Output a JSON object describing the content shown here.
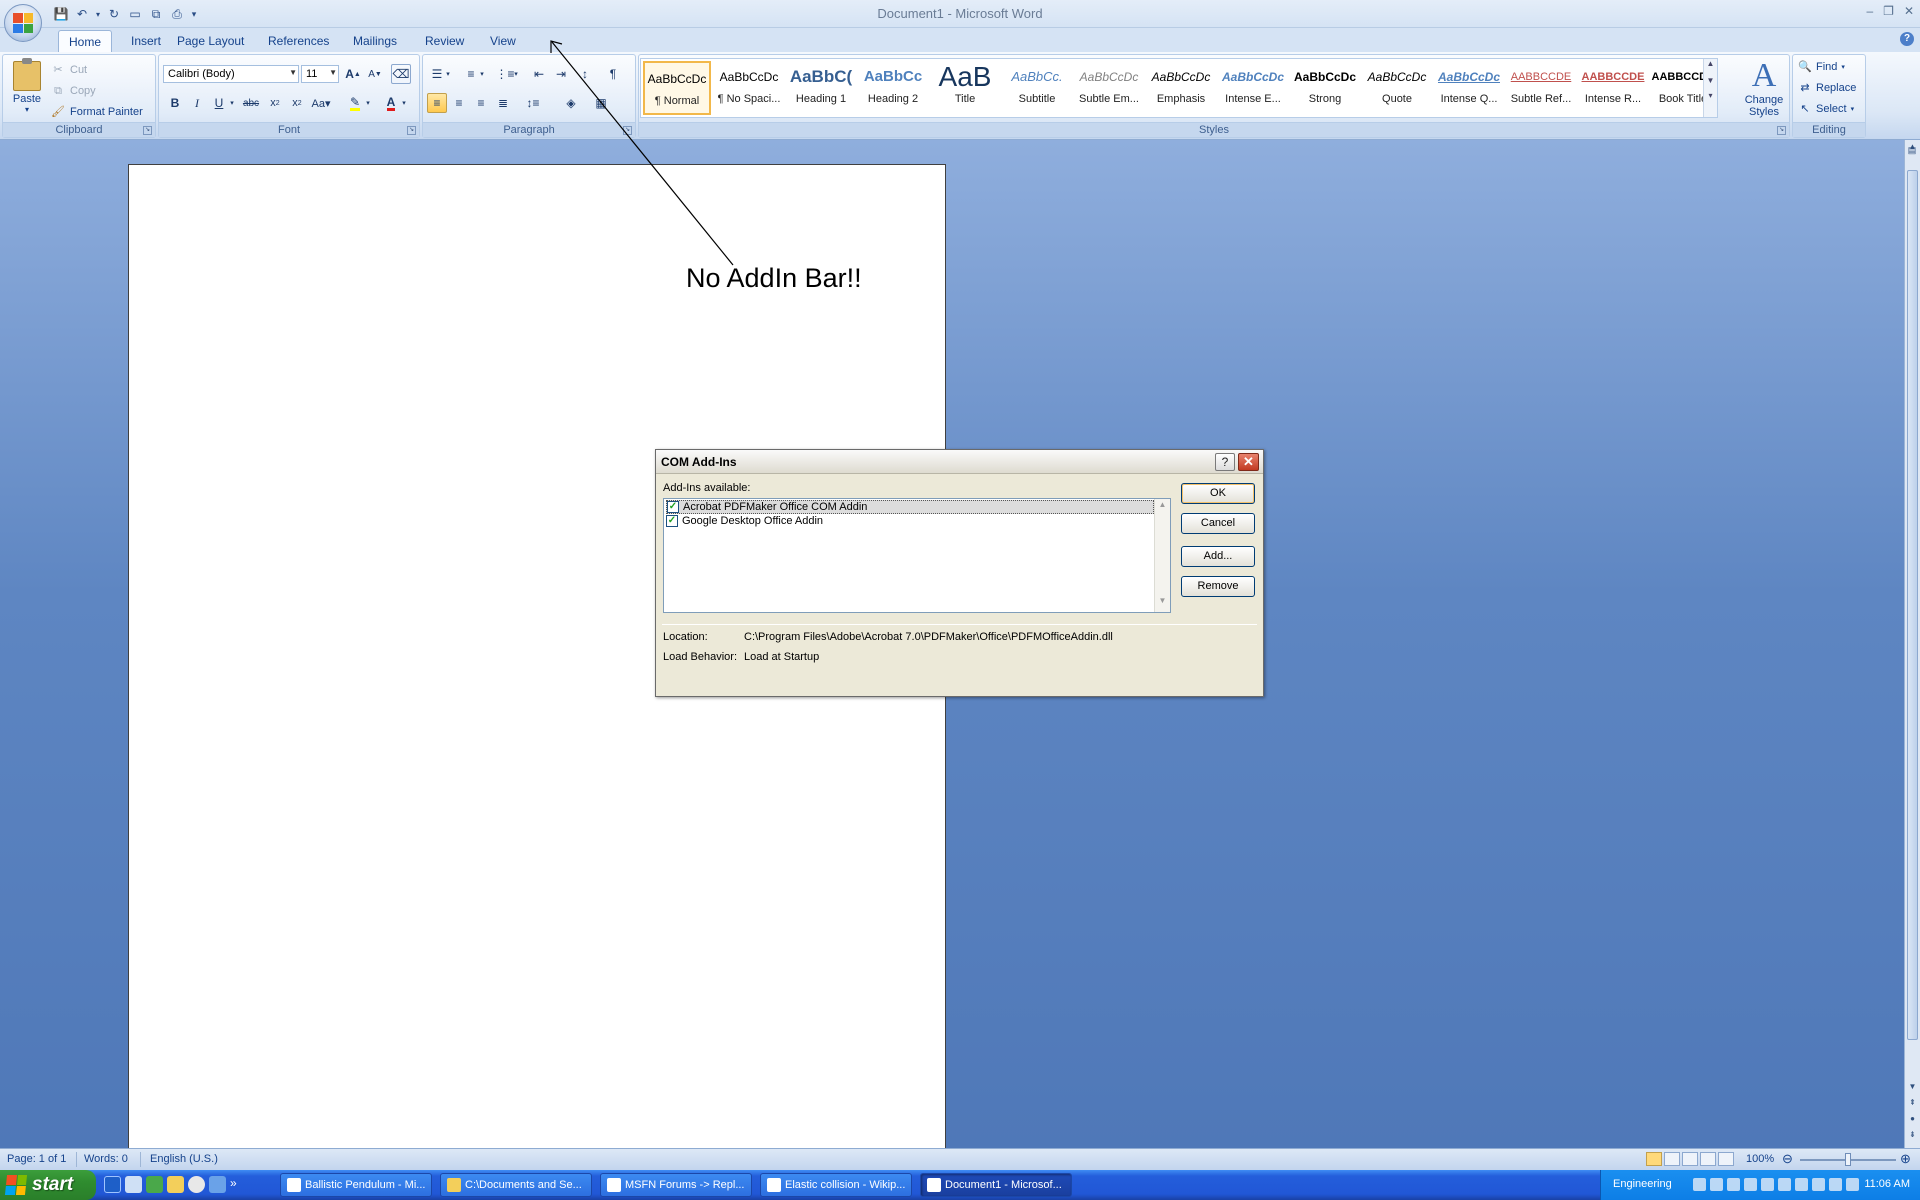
{
  "window": {
    "title": "Document1 - Microsoft Word",
    "controls": [
      "–",
      "❐",
      "✕"
    ]
  },
  "tabs": [
    "Home",
    "Insert",
    "Page Layout",
    "References",
    "Mailings",
    "Review",
    "View"
  ],
  "active_tab": "Home",
  "ribbon": {
    "clipboard": {
      "label": "Clipboard",
      "paste": "Paste",
      "cut": "Cut",
      "copy": "Copy",
      "format_painter": "Format Painter"
    },
    "font": {
      "label": "Font",
      "font_name": "Calibri (Body)",
      "font_size": "11"
    },
    "paragraph": {
      "label": "Paragraph"
    },
    "styles": {
      "label": "Styles",
      "items": [
        {
          "sample": "AaBbCcDc",
          "name": "¶ Normal"
        },
        {
          "sample": "AaBbCcDc",
          "name": "¶ No Spaci..."
        },
        {
          "sample": "AaBbC(",
          "name": "Heading 1"
        },
        {
          "sample": "AaBbCc",
          "name": "Heading 2"
        },
        {
          "sample": "AaB",
          "name": "Title"
        },
        {
          "sample": "AaBbCc.",
          "name": "Subtitle"
        },
        {
          "sample": "AaBbCcDc",
          "name": "Subtle Em..."
        },
        {
          "sample": "AaBbCcDc",
          "name": "Emphasis"
        },
        {
          "sample": "AaBbCcDc",
          "name": "Intense E..."
        },
        {
          "sample": "AaBbCcDc",
          "name": "Strong"
        },
        {
          "sample": "AaBbCcDc",
          "name": "Quote"
        },
        {
          "sample": "AaBbCcDc",
          "name": "Intense Q..."
        },
        {
          "sample": "AABBCCDE",
          "name": "Subtle Ref..."
        },
        {
          "sample": "AABBCCDE",
          "name": "Intense R..."
        },
        {
          "sample": "AABBCCDE",
          "name": "Book Title"
        }
      ],
      "change_styles": "Change Styles"
    },
    "editing": {
      "label": "Editing",
      "find": "Find",
      "replace": "Replace",
      "select": "Select"
    }
  },
  "annotation": "No AddIn Bar!!",
  "dialog": {
    "title": "COM Add-Ins",
    "list_label": "Add-Ins available:",
    "addins": [
      {
        "name": "Acrobat PDFMaker Office COM Addin",
        "checked": true
      },
      {
        "name": "Google Desktop Office Addin",
        "checked": true
      }
    ],
    "buttons": {
      "ok": "OK",
      "cancel": "Cancel",
      "add": "Add...",
      "remove": "Remove"
    },
    "location_label": "Location:",
    "location_value": "C:\\Program Files\\Adobe\\Acrobat 7.0\\PDFMaker\\Office\\PDFMOfficeAddin.dll",
    "load_label": "Load Behavior:",
    "load_value": "Load at Startup"
  },
  "statusbar": {
    "page": "Page: 1 of 1",
    "words": "Words: 0",
    "language": "English (U.S.)",
    "zoom": "100%"
  },
  "taskbar": {
    "start": "start",
    "tasks": [
      {
        "label": "Ballistic Pendulum - Mi..."
      },
      {
        "label": "C:\\Documents and Se..."
      },
      {
        "label": "MSFN Forums -> Repl..."
      },
      {
        "label": "Elastic collision - Wikip..."
      },
      {
        "label": "Document1 - Microsof..."
      }
    ],
    "language": "Engineering",
    "clock": "11:06 AM"
  }
}
